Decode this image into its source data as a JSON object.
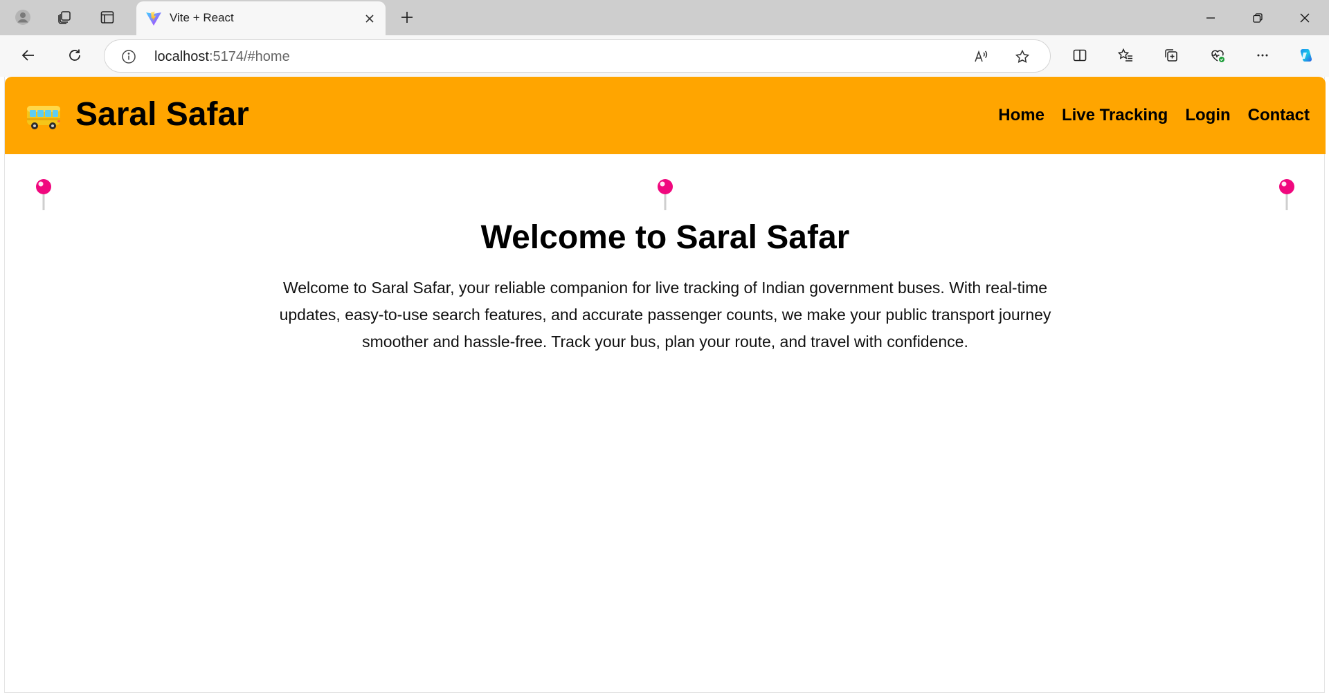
{
  "browser": {
    "tab": {
      "title": "Vite + React"
    },
    "address_bar": {
      "host": "localhost",
      "rest": ":5174/#home"
    },
    "icons": {
      "profile": "profile-icon",
      "workspaces": "workspaces-icon",
      "tab_actions": "tab-actions-icon",
      "new_tab": "plus-icon",
      "back": "back-arrow-icon",
      "reload": "reload-icon",
      "site_info": "info-icon",
      "read_aloud": "read-aloud-icon",
      "add_favorite": "star-icon",
      "split_screen": "split-screen-icon",
      "favorites": "favorites-icon",
      "collections": "collections-icon",
      "browser_essentials": "heart-pulse-icon",
      "more": "ellipsis-icon",
      "copilot": "copilot-icon"
    }
  },
  "site": {
    "brand": {
      "logo_icon": "bus-icon",
      "title": "Saral Safar"
    },
    "nav": [
      {
        "label": "Home"
      },
      {
        "label": "Live Tracking"
      },
      {
        "label": "Login"
      },
      {
        "label": "Contact"
      }
    ],
    "hero": {
      "title": "Welcome to Saral Safar",
      "text": "Welcome to Saral Safar, your reliable companion for live tracking of Indian government buses. With real-time updates, easy-to-use search features, and accurate passenger counts, we make your public transport journey smoother and hassle-free. Track your bus, plan your route, and travel with confidence."
    },
    "decorations": {
      "pin_icon": "pushpin-icon"
    }
  },
  "colors": {
    "header_bg": "#ffa500",
    "pin": "#f0087e",
    "tabstrip_bg": "#cecece",
    "toolbar_bg": "#f7f7f7"
  }
}
